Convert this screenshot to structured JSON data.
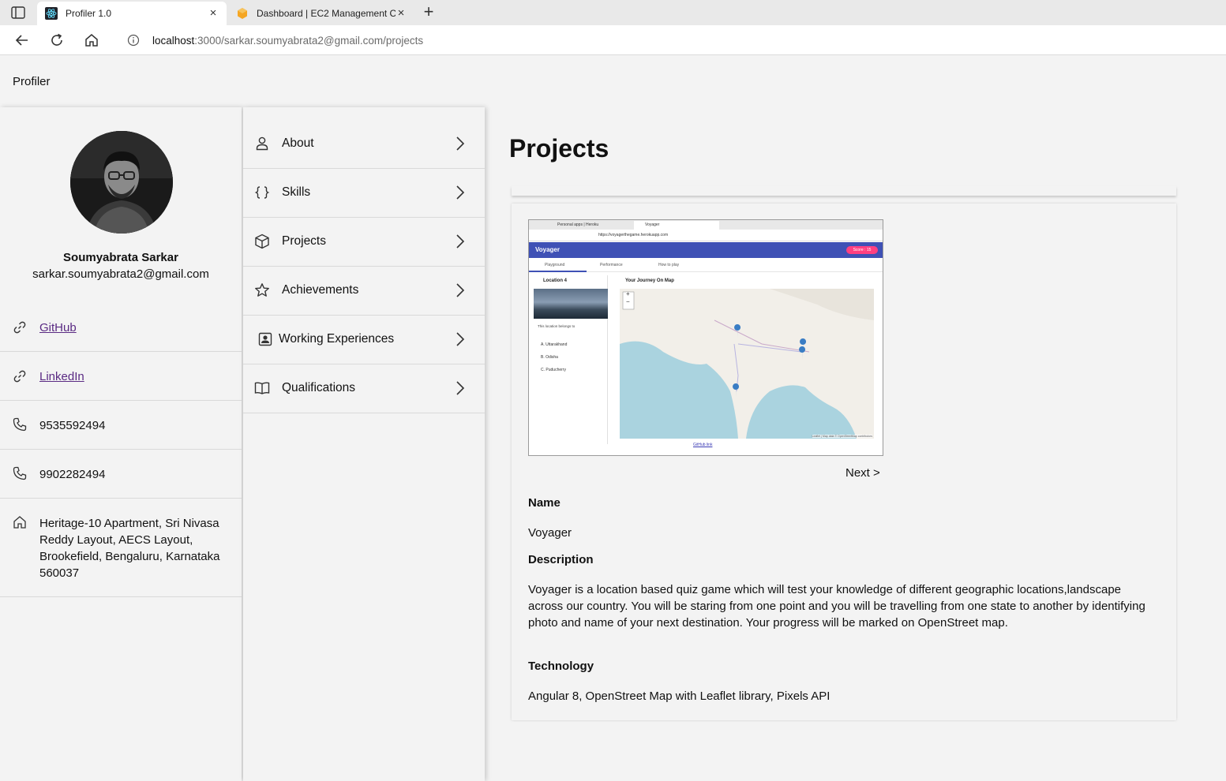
{
  "browser": {
    "tabs": [
      {
        "title": "Profiler 1.0",
        "active": true,
        "icon": "react-icon"
      },
      {
        "title": "Dashboard | EC2 Management C",
        "active": false,
        "icon": "aws-icon"
      }
    ],
    "new_tab_label": "+",
    "close_label": "×",
    "url_host": "localhost",
    "url_path": ":3000/sarkar.soumyabrata2@gmail.com/projects"
  },
  "app": {
    "title": "Profiler"
  },
  "profile": {
    "name": "Soumyabrata Sarkar",
    "email": "sarkar.soumyabrata2@gmail.com",
    "contacts": [
      {
        "type": "link",
        "icon": "link-icon",
        "text": "GitHub"
      },
      {
        "type": "link",
        "icon": "link-icon",
        "text": "LinkedIn"
      },
      {
        "type": "phone",
        "icon": "phone-icon",
        "text": "9535592494"
      },
      {
        "type": "phone",
        "icon": "phone-icon",
        "text": "9902282494"
      },
      {
        "type": "address",
        "icon": "home-icon",
        "text": "Heritage-10 Apartment, Sri Nivasa Reddy Layout, AECS Layout, Brookefield, Bengaluru, Karnataka 560037"
      }
    ]
  },
  "menu": {
    "items": [
      {
        "label": "About",
        "icon": "person-icon"
      },
      {
        "label": "Skills",
        "icon": "braces-icon"
      },
      {
        "label": "Projects",
        "icon": "cube-icon"
      },
      {
        "label": "Achievements",
        "icon": "star-icon"
      },
      {
        "label": "Working Experiences",
        "icon": "badge-icon"
      },
      {
        "label": "Qualifications",
        "icon": "book-icon"
      }
    ]
  },
  "main": {
    "title": "Projects",
    "next_label": "Next >",
    "project": {
      "name_label": "Name",
      "name": "Voyager",
      "description_label": "Description",
      "description": "Voyager is a location based quiz game which will test your knowledge of different geographic locations,landscape across our country. You will be staring from one point and you will be travelling from one state to another by identifying photo and name of your next destination. Your progress will be marked on OpenStreet map.",
      "technology_label": "Technology",
      "technology": "Angular 8, OpenStreet Map with Leaflet library, Pixels API"
    },
    "screenshot": {
      "tab1": "Personal apps | Heroku",
      "tab2": "Voyager",
      "url": "https://voyagerthegame.herokuapp.com",
      "brand": "Voyager",
      "score": "Score : 15",
      "tabs": [
        "Playground",
        "Performance",
        "How to play"
      ],
      "location": "Location 4",
      "question": "This location belongs to",
      "options": [
        "A. Uttarakhand",
        "B. Odisha",
        "C. Puducherry"
      ],
      "map_title": "Your Journey On Map",
      "zoom_in": "+",
      "zoom_out": "−",
      "attribution": "Leaflet | Map data © OpenStreetMap contributors",
      "link": "GitHub link"
    }
  },
  "colors": {
    "page_bg": "#f3f3f3",
    "link": "#5a2a83",
    "mini_header": "#3f51b5",
    "mini_score": "#ff4081",
    "map_water": "#aad3df"
  }
}
